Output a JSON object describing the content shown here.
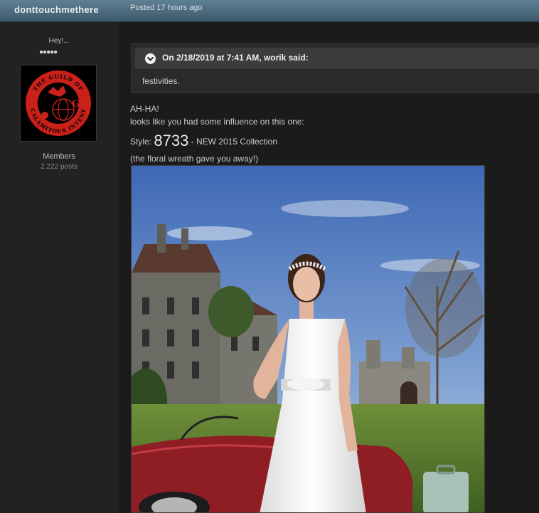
{
  "post": {
    "author": "donttouchmethere",
    "posted": "Posted 17 hours ago"
  },
  "profile": {
    "title": "Hey!...",
    "pips": "●●●●●",
    "avatar_icon": "guild-emblem-icon",
    "avatar_text": "THE GUILD OF CALAMITOUS INTENT",
    "group": "Members",
    "post_count": "2,222 posts"
  },
  "quote": {
    "citation": "On 2/18/2019 at 7:41 AM, worik said:",
    "body": "festivities."
  },
  "content": {
    "line1": "AH-HA!",
    "line2": "looks like you had some influence on this one:",
    "style_label": "Style:",
    "style_number": "8733",
    "style_rest": " - NEW 2015 Collection",
    "line4": "(the floral wreath gave you away!)"
  },
  "colors": {
    "header_bar": "#4d6c80",
    "page_bg": "#1b1b1b",
    "sidebar_bg": "#222222",
    "quote_head_bg": "#3c3c3c",
    "emblem_red": "#c9201a"
  }
}
